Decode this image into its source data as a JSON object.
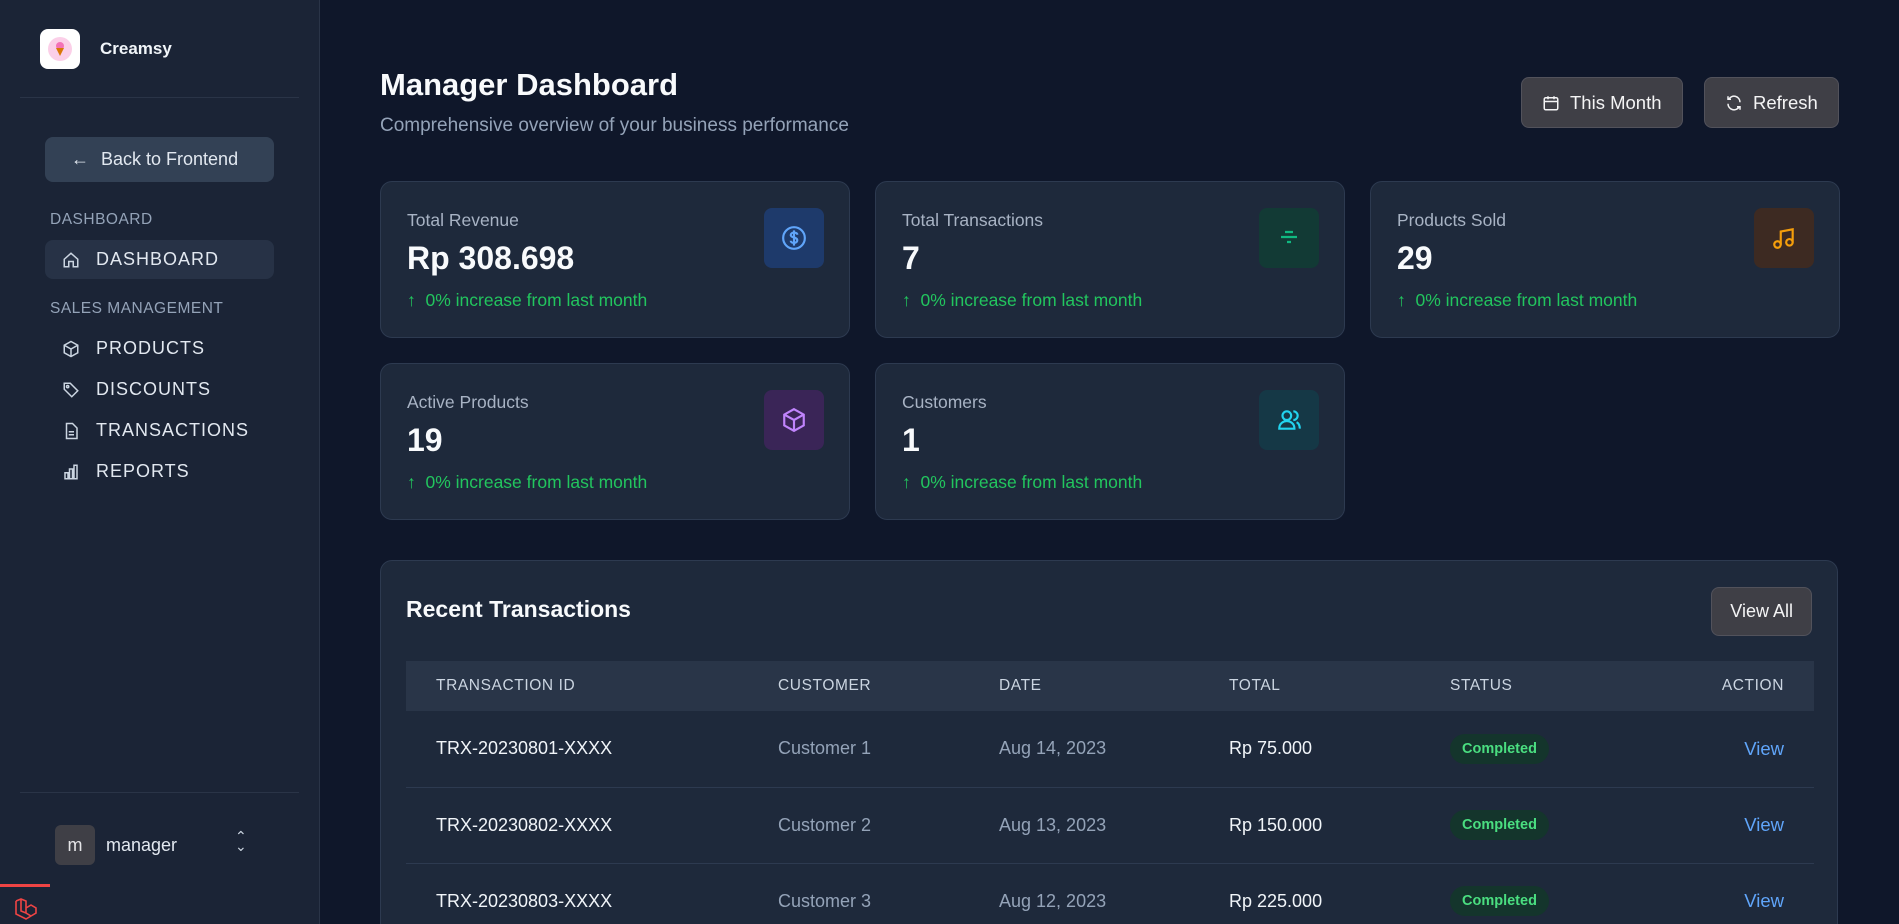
{
  "brand": {
    "name": "Creamsy",
    "logo_icon": "ice-cream-icon"
  },
  "sidebar": {
    "back_label": "Back to Frontend",
    "sections": [
      {
        "label": "DASHBOARD"
      },
      {
        "label": "SALES MANAGEMENT"
      }
    ],
    "items": [
      {
        "label": "DASHBOARD",
        "icon": "home-icon",
        "active": true
      },
      {
        "label": "PRODUCTS",
        "icon": "cube-icon"
      },
      {
        "label": "DISCOUNTS",
        "icon": "tag-icon"
      },
      {
        "label": "TRANSACTIONS",
        "icon": "document-icon"
      },
      {
        "label": "REPORTS",
        "icon": "bar-chart-icon"
      }
    ],
    "user": {
      "initial": "m",
      "name": "manager"
    }
  },
  "header": {
    "title": "Manager Dashboard",
    "subtitle": "Comprehensive overview of your business performance",
    "period_label": "This Month",
    "refresh_label": "Refresh"
  },
  "stats": [
    {
      "label": "Total Revenue",
      "value": "Rp 308.698",
      "change": "0% increase from last month",
      "icon": "dollar-icon",
      "color": "#3b82f6"
    },
    {
      "label": "Total Transactions",
      "value": "7",
      "change": "0% increase from last month",
      "icon": "filter-icon",
      "color": "#10b981"
    },
    {
      "label": "Products Sold",
      "value": "29",
      "change": "0% increase from last month",
      "icon": "music-note-icon",
      "color": "#f59e0b"
    },
    {
      "label": "Active Products",
      "value": "19",
      "change": "0% increase from last month",
      "icon": "cube-icon",
      "color": "#a855f7"
    },
    {
      "label": "Customers",
      "value": "1",
      "change": "0% increase from last month",
      "icon": "users-icon",
      "color": "#06b6d4"
    }
  ],
  "transactions": {
    "title": "Recent Transactions",
    "view_all_label": "View All",
    "columns": [
      "TRANSACTION ID",
      "CUSTOMER",
      "DATE",
      "TOTAL",
      "STATUS",
      "ACTION"
    ],
    "rows": [
      {
        "id": "TRX-20230801-XXXX",
        "customer": "Customer 1",
        "date": "Aug 14, 2023",
        "total": "Rp 75.000",
        "status": "Completed",
        "action": "View"
      },
      {
        "id": "TRX-20230802-XXXX",
        "customer": "Customer 2",
        "date": "Aug 13, 2023",
        "total": "Rp 150.000",
        "status": "Completed",
        "action": "View"
      },
      {
        "id": "TRX-20230803-XXXX",
        "customer": "Customer 3",
        "date": "Aug 12, 2023",
        "total": "Rp 225.000",
        "status": "Completed",
        "action": "View"
      }
    ]
  }
}
